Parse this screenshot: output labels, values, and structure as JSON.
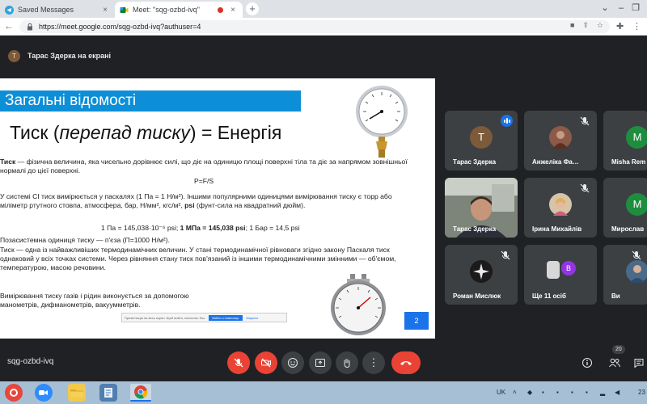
{
  "browser": {
    "tabs": [
      {
        "label": "Saved Messages",
        "active": false
      },
      {
        "label": "Meet: \"sqg-ozbd-ivq\"",
        "active": true
      }
    ],
    "url": "https://meet.google.com/sqg-ozbd-ivq?authuser=4"
  },
  "meet": {
    "presenter_banner": "Тарас Здерка на екрані",
    "presenter_initial": "Т",
    "meeting_code": "sqg-ozbd-ivq",
    "participants_count": "20"
  },
  "slide": {
    "title": "Загальні відомості",
    "heading_prefix": "Тиск (",
    "heading_italic": "перепад тиску",
    "heading_suffix": ") = Енергія",
    "p1_bold": "Тиск",
    "p1_rest": " — фізична величина, яка чисельно дорівнює силі, що діє на одиницю площі поверхні тіла та діє за напрямом зовнішньої нормалі до цієї поверхні.",
    "formula": "P=F/S",
    "p2_main": "У системі СІ тиск вимірюється у паскалях (1 Па = 1 Н/м²). Іншими популярними одиницями вимірювання тиску є торр або міліметр ртутного стовпа, атмосфера, бар, Н/мм², кгс/м², ",
    "p2_psi": "psi",
    "p2_tail": " (фунт-сила на квадратний дюйм).",
    "conversion_a": "1 Па = 145,038·10⁻⁶ psi; ",
    "conversion_b": "1 МПа = 145,038 psi",
    "conversion_c": ";  1 Бар = 14,5 psi",
    "p3": "Позасистемна одиниця тиску — п'єза (П=1000 Н/м²).",
    "p4": "Тиск — одна із найважливіших термодинамічних величин. У стані термодинамічної рівноваги згідно закону Паскаля тиск однаковий у всіх точках системи. Через рівняння стану тиск пов'язаний  із іншими термодинамічними змінними — об'ємом, температурою, масою речовини.",
    "p5": "Вимірювання тиску газів і рідин виконується за допомогою манометрів, дифманометрів, вакуумметрів.",
    "page_number": "2",
    "banner_text": "Презентація на весь екран. Щоб вийти, натисніть Esc.",
    "banner_button": "Вийти з повноекр.",
    "banner_link": "Закрити"
  },
  "tiles": [
    {
      "name": "Тарас Здерка",
      "initial": "Т",
      "avatar_color": "#7c5a3a",
      "state": "speaking"
    },
    {
      "name": "Анжеліка Фа…",
      "initial": "",
      "avatar_color": "#8b5a48",
      "state": "muted"
    },
    {
      "name": "Misha Rem",
      "initial": "M",
      "avatar_color": "#1e8e3e",
      "state": "muted"
    },
    {
      "name": "Тарас Здерка",
      "initial": "",
      "avatar_color": "",
      "state": "video"
    },
    {
      "name": "Ірина Михайлів",
      "initial": "",
      "avatar_color": "#d6c3a8",
      "state": "muted"
    },
    {
      "name": "Мирослав",
      "initial": "M",
      "avatar_color": "#1e8e3e",
      "state": "muted"
    },
    {
      "name": "Роман Мислюк",
      "initial": "",
      "avatar_color": "#222",
      "state": "muted"
    },
    {
      "name": "Ще 11 осіб",
      "initial": "B",
      "avatar_color": "#9334e6",
      "state": "none"
    },
    {
      "name": "Ви",
      "initial": "",
      "avatar_color": "#4a6a8a",
      "state": "muted"
    }
  ],
  "taskbar": {
    "lang": "UK",
    "clock_fragment": "23"
  }
}
